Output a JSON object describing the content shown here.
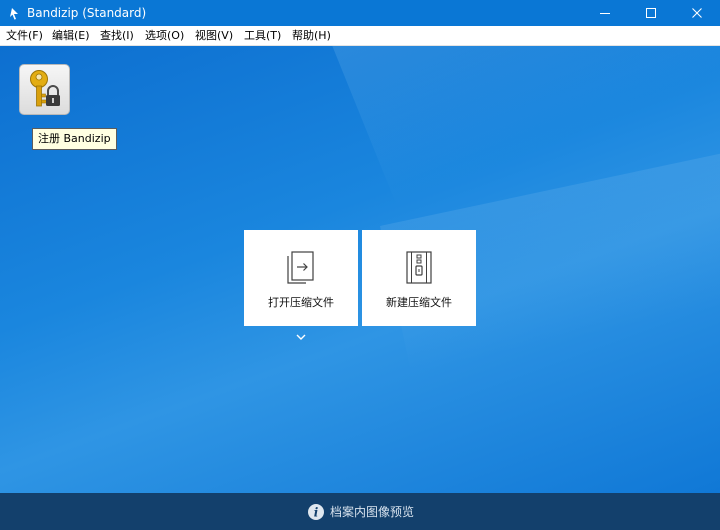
{
  "window": {
    "title": "Bandizip (Standard)",
    "app_icon": "bandizip-icon",
    "controls": [
      "minimize-icon",
      "maximize-icon",
      "close-icon"
    ]
  },
  "menu": {
    "items": [
      {
        "label": "文件(F)"
      },
      {
        "label": "编辑(E)"
      },
      {
        "label": "查找(I)"
      },
      {
        "label": "选项(O)"
      },
      {
        "label": "视图(V)"
      },
      {
        "label": "工具(T)"
      },
      {
        "label": "帮助(H)"
      }
    ]
  },
  "register": {
    "icon": "key-lock-icon",
    "tooltip": "注册 Bandizip"
  },
  "actions": [
    {
      "label": "打开压缩文件",
      "icon": "open-archive-icon"
    },
    {
      "label": "新建压缩文件",
      "icon": "new-archive-icon"
    }
  ],
  "status": {
    "icon": "info-icon",
    "text": "档案内图像预览"
  },
  "colors": {
    "titlebar": "#0a77d5",
    "workspace": "#1a86de",
    "statusbar": "#13406c",
    "tooltip_bg": "#ffffe1"
  }
}
